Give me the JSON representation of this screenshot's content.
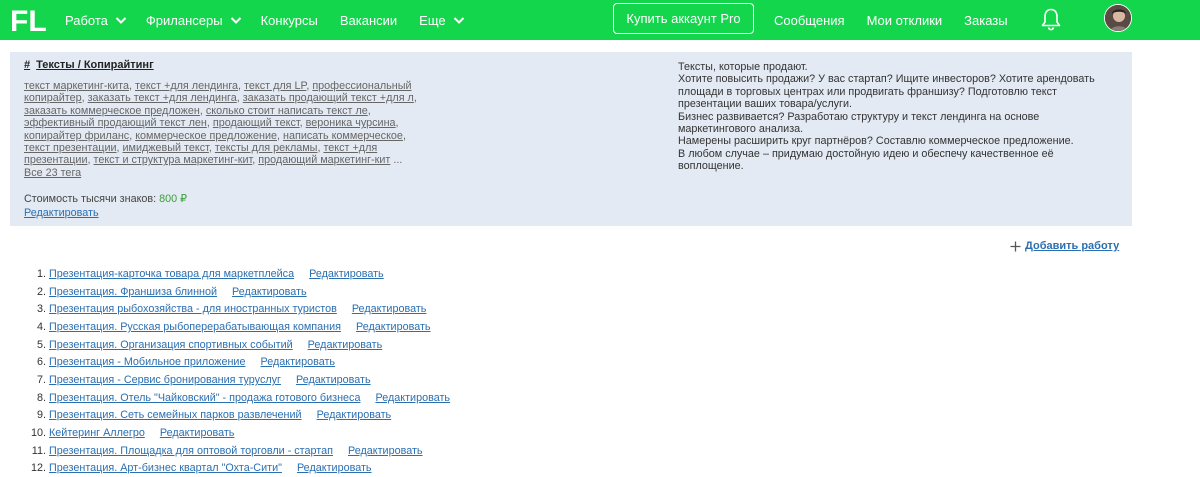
{
  "header": {
    "logo": "FL",
    "nav": [
      {
        "label": "Работа",
        "chevron": true
      },
      {
        "label": "Фрилансеры",
        "chevron": true
      },
      {
        "label": "Конкурсы",
        "chevron": false
      },
      {
        "label": "Вакансии",
        "chevron": false
      },
      {
        "label": "Еще",
        "chevron": true
      }
    ],
    "pro_button": "Купить аккаунт Pro",
    "right_nav": [
      "Сообщения",
      "Мои отклики",
      "Заказы"
    ],
    "bell_icon": "bell-icon",
    "brand_color": "#14d64c"
  },
  "category": {
    "hash": "#",
    "title": "Тексты / Копирайтинг",
    "tags": [
      "текст маркетинг-кита",
      "текст +для лендинга",
      "текст для LP",
      "профессиональный копирайтер",
      "заказать текст +для лендинга",
      "заказать продающий текст +для л",
      "заказать коммерческое предложен",
      "сколько стоит написать текст ле",
      "эффективный продающий текст лен",
      "продающий текст",
      "вероника чурсина",
      "копирайтер фриланс",
      "коммерческое предложение",
      "написать коммерческое",
      "текст презентации",
      "имиджевый текст",
      "тексты для рекламы",
      "текст +для презентации",
      "текст и структура маркетинг-кит",
      "продающий маркетинг-кит"
    ],
    "ellipsis": "...",
    "all_tags": "Все 23 тега",
    "price_label": "Стоимость тысячи знаков:",
    "price_value": "800 ₽",
    "edit": "Редактировать",
    "description": [
      "Тексты, которые продают.",
      "Хотите повысить продажи? У вас стартап? Ищите инвесторов? Хотите арендовать площади в торговых центрах или продвигать франшизу? Подготовлю текст презентации ваших товара/услуги.",
      "Бизнес развивается? Разработаю структуру и текст лендинга на основе маркетингового анализа.",
      "Намерены расширить круг партнёров? Составлю коммерческое предложение.",
      "В любом случае – придумаю достойную идею и обеспечу качественное её воплощение."
    ]
  },
  "add_work": "Добавить работу",
  "works_edit_label": "Редактировать",
  "works": [
    {
      "num": "1.",
      "title": "Презентация-карточка товара для маркетплейса"
    },
    {
      "num": "2.",
      "title": "Презентация. Франшиза блинной"
    },
    {
      "num": "3.",
      "title": "Презентация рыбохозяйства - для иностранных туристов"
    },
    {
      "num": "4.",
      "title": "Презентация. Русская рыбоперерабатывающая компания"
    },
    {
      "num": "5.",
      "title": "Презентация. Организация спортивных событий"
    },
    {
      "num": "6.",
      "title": "Презентация - Мобильное приложение"
    },
    {
      "num": "7.",
      "title": "Презентация - Сервис бронирования туруслуг"
    },
    {
      "num": "8.",
      "title": "Презентация. Отель \"Чайковский\" - продажа готового бизнеса"
    },
    {
      "num": "9.",
      "title": "Презентация. Сеть семейных парков развлечений"
    },
    {
      "num": "10.",
      "title": "Кейтеринг Аллегро"
    },
    {
      "num": "11.",
      "title": "Презентация. Площадка для оптовой торговли - стартап"
    },
    {
      "num": "12.",
      "title": "Презентация. Арт-бизнес квартал \"Охта-Сити\""
    }
  ]
}
